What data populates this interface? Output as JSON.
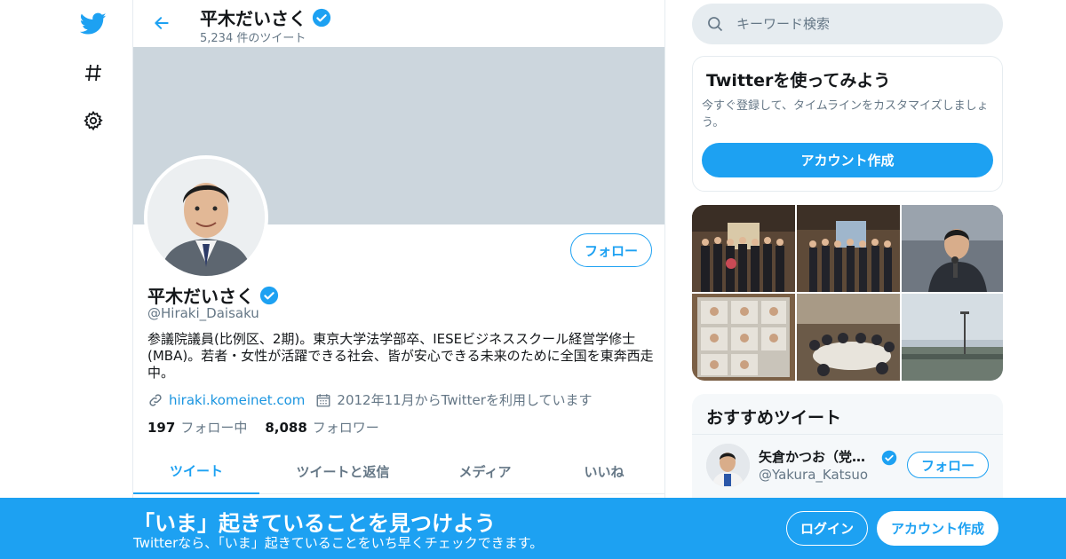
{
  "colors": {
    "accent": "#1da1f2",
    "banner": "#ccd6dd",
    "muted": "#657786",
    "text": "#14171a"
  },
  "nav": {
    "icons": [
      "twitter-logo-icon",
      "hashtag-icon",
      "gear-icon"
    ]
  },
  "header": {
    "title": "平木だいさく",
    "tweet_count": "5,234 件のツイート"
  },
  "profile": {
    "name": "平木だいさく",
    "handle": "@Hiraki_Daisaku",
    "bio": "参議院議員(比例区、2期)。東京大学法学部卒、IESEビジネススクール経営学修士(MBA)。若者・女性が活躍できる社会、皆が安心できる未来のために全国を東奔西走中。",
    "website": "hiraki.komeinet.com",
    "joined": "2012年11月からTwitterを利用しています",
    "follow_label": "フォロー",
    "following_count": "197",
    "following_label": "フォロー中",
    "followers_count": "8,088",
    "followers_label": "フォロワー"
  },
  "tabs": [
    {
      "label": "ツイート",
      "active": true
    },
    {
      "label": "ツイートと返信",
      "active": false
    },
    {
      "label": "メディア",
      "active": false
    },
    {
      "label": "いいね",
      "active": false
    }
  ],
  "search": {
    "placeholder": "キーワード検索"
  },
  "signup_card": {
    "title": "Twitterを使ってみよう",
    "description": "今すぐ登録して、タイムラインをカスタマイズしましょう。",
    "button": "アカウント作成"
  },
  "recommended": {
    "title": "おすすめツイート",
    "user": {
      "name": "矢倉かつお（党…",
      "handle": "@Yakura_Katsuo",
      "follow_label": "フォロー"
    }
  },
  "bottom_bar": {
    "title": "「いま」起きていることを見つけよう",
    "subtitle": "Twitterなら、「いま」起きていることをいち早くチェックできます。",
    "login": "ログイン",
    "signup": "アカウント作成"
  }
}
